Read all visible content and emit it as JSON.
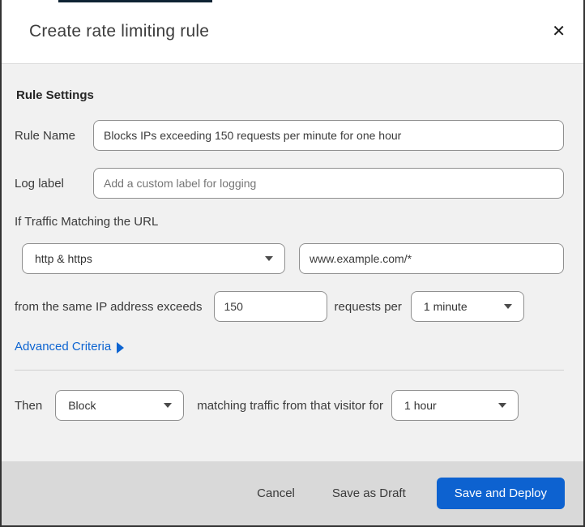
{
  "dialog": {
    "title": "Create rate limiting rule",
    "close_glyph": "✕"
  },
  "rule_settings": {
    "heading": "Rule Settings",
    "rule_name": {
      "label": "Rule Name",
      "value": "Blocks IPs exceeding 150 requests per minute for one hour"
    },
    "log_label": {
      "label": "Log label",
      "placeholder": "Add a custom label for logging"
    },
    "traffic": {
      "intro": "If Traffic Matching the URL",
      "scheme_selected": "http & https",
      "url_value": "www.example.com/*",
      "threshold_prefix": "from the same IP address exceeds",
      "threshold_value": "150",
      "threshold_suffix": "requests per",
      "period_selected": "1 minute"
    },
    "advanced_criteria_label": "Advanced Criteria"
  },
  "action": {
    "then_label": "Then",
    "action_selected": "Block",
    "middle_text": "matching traffic from that visitor for",
    "duration_selected": "1 hour"
  },
  "footer": {
    "cancel_label": "Cancel",
    "save_draft_label": "Save as Draft",
    "save_deploy_label": "Save and Deploy"
  },
  "colors": {
    "primary_button": "#0d62d0",
    "link_blue": "#0d64d1",
    "body_bg": "#f1f1f1",
    "footer_bg": "#d9d9d9",
    "accent_bar": "#0e2333"
  }
}
